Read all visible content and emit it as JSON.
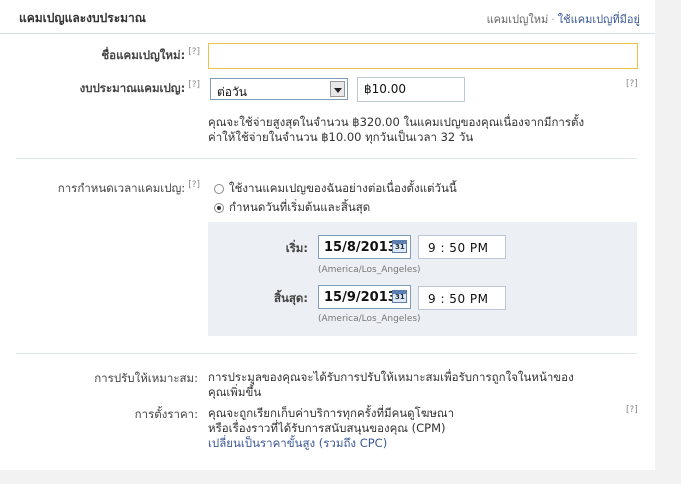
{
  "header": {
    "title": "แคมเปญและงบประมาณ",
    "new_campaign": "แคมเปญใหม่",
    "separator": "·",
    "existing_campaign": "ใช้แคมเปญที่มีอยู่"
  },
  "help": "[?]",
  "campaign_name": {
    "label": "ชื่อแคมเปญใหม่:",
    "value": ""
  },
  "budget": {
    "label": "งบประมาณแคมเปญ:",
    "period_selected": "ต่อวัน",
    "amount": "฿10.00",
    "note_line1": "คุณจะใช้จ่ายสูงสุดในจำนวน ฿320.00 ในแคมเปญของคุณเนื่องจากมีการตั้ง",
    "note_line2": "ค่าให้ใช้จ่ายในจำนวน ฿10.00 ทุกวันเป็นเวลา 32 วัน"
  },
  "schedule": {
    "label": "การกำหนดเวลาแคมเปญ:",
    "option_continuous": "ใช้งานแคมเปญของฉันอย่างต่อเนื่องตั้งแต่วันนี้",
    "option_range": "กำหนดวันที่เริ่มต้นและสิ้นสุด",
    "selected": "option_range",
    "start_label": "เริ่ม:",
    "start_date": "15/8/2013",
    "start_time": "9 : 50  PM",
    "end_label": "สิ้นสุด:",
    "end_date": "15/9/2013",
    "end_time": "9 : 50  PM",
    "timezone": "(America/Los_Angeles)"
  },
  "optimization": {
    "label": "การปรับให้เหมาะสม:",
    "text_line1": "การประมูลของคุณจะได้รับการปรับให้เหมาะสมเพื่อรับการถูกใจในหน้าของ",
    "text_line2": "คุณเพิ่มขึ้น"
  },
  "pricing": {
    "label": "การตั้งราคา:",
    "text_line1": "คุณจะถูกเรียกเก็บค่าบริการทุกครั้งที่มีคนดูโฆษณา",
    "text_line2": "หรือเรื่องราวที่ได้รับการสนับสนุนของคุณ (CPM)",
    "advanced_link": "เปลี่ยนเป็นราคาขั้นสูง (รวมถึง CPC)"
  }
}
